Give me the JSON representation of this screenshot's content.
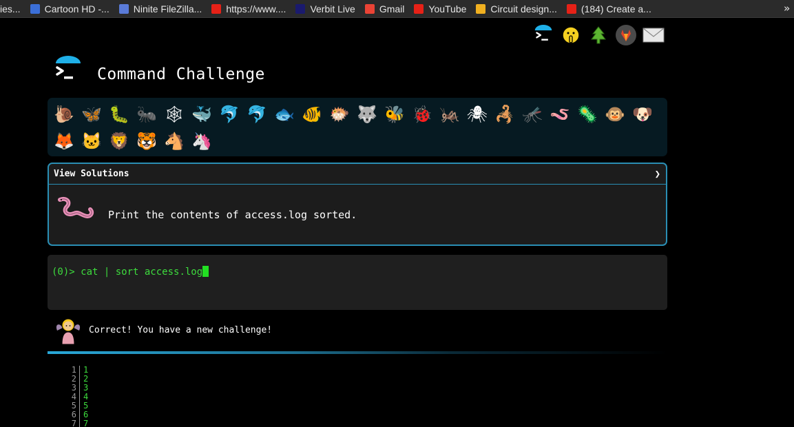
{
  "bookmarks": [
    {
      "label": "ies...",
      "color": "#2b2b2b"
    },
    {
      "label": "Cartoon HD -...",
      "color": "#3b6fd8"
    },
    {
      "label": "Ninite FileZilla...",
      "color": "#5a7bd8"
    },
    {
      "label": "https://www....",
      "color": "#e62117"
    },
    {
      "label": "Verbit Live",
      "color": "#1a1a6e"
    },
    {
      "label": "Gmail",
      "color": "#ea4335"
    },
    {
      "label": "YouTube",
      "color": "#e62117"
    },
    {
      "label": "Circuit design...",
      "color": "#f0b020"
    },
    {
      "label": "(184) Create a...",
      "color": "#e62117"
    }
  ],
  "bookmarks_more": "»",
  "header": {
    "title": "Command Challenge"
  },
  "critters": [
    "🐌",
    "🦋",
    "🐛",
    "🐜",
    "🕸",
    "🐳",
    "🐬",
    "🐬",
    "🐟",
    "🐠",
    "🐡",
    "🐺",
    "🐝",
    "🐞",
    "🦗",
    "🕷",
    "🦂",
    "🦟",
    "🪱",
    "🦠",
    "🐵",
    "🐶",
    "🦊",
    "🐱",
    "🦁",
    "🐯",
    "🐴",
    "🦄"
  ],
  "solutions": {
    "label": "View Solutions",
    "chevron": "❯",
    "challenge": "Print the contents of access.log sorted."
  },
  "terminal": {
    "prompt": "(0)> ",
    "command": "cat | sort access.log"
  },
  "feedback": {
    "message": "Correct! You have a new challenge!"
  },
  "output": {
    "line_numbers": [
      "1",
      "2",
      "3",
      "4",
      "5",
      "6",
      "7"
    ],
    "lines": [
      "1",
      "2",
      "3",
      "4",
      "5",
      "6",
      "7"
    ]
  },
  "colors": {
    "accent": "#2a8fb5",
    "terminal_text": "#3ddc3d",
    "critter_bar": "#061a22"
  }
}
